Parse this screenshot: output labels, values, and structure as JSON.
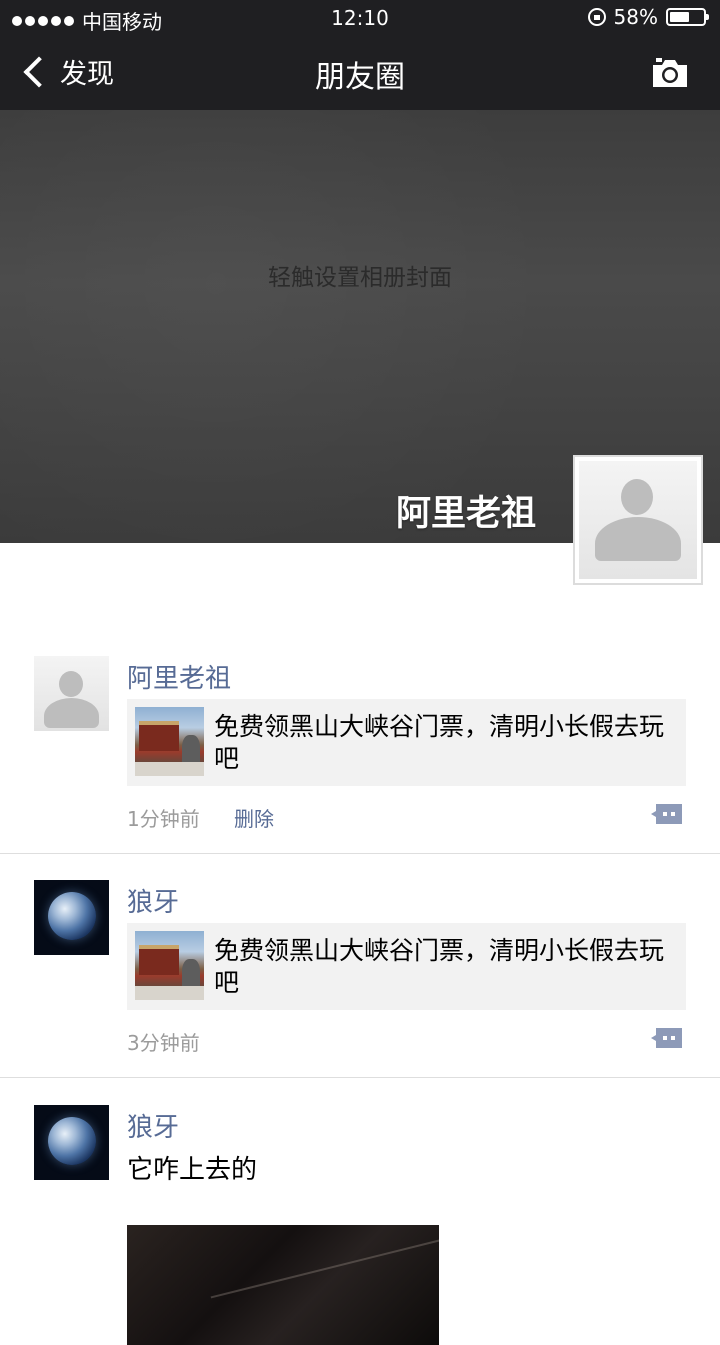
{
  "status_bar": {
    "carrier": "中国移动",
    "time": "12:10",
    "battery": "58%",
    "battery_level": 0.58
  },
  "nav": {
    "back_label": "发现",
    "title": "朋友圈"
  },
  "cover": {
    "hint": "轻触设置相册封面",
    "profile_name": "阿里老祖"
  },
  "posts": [
    {
      "author": "阿里老祖",
      "link_title": "免费领黑山大峡谷门票，清明小长假去玩吧",
      "time": "1分钟前",
      "delete_label": "删除"
    },
    {
      "author": "狼牙",
      "link_title": "免费领黑山大峡谷门票，清明小长假去玩吧",
      "time": "3分钟前"
    },
    {
      "author": "狼牙",
      "text": "它咋上去的"
    }
  ]
}
